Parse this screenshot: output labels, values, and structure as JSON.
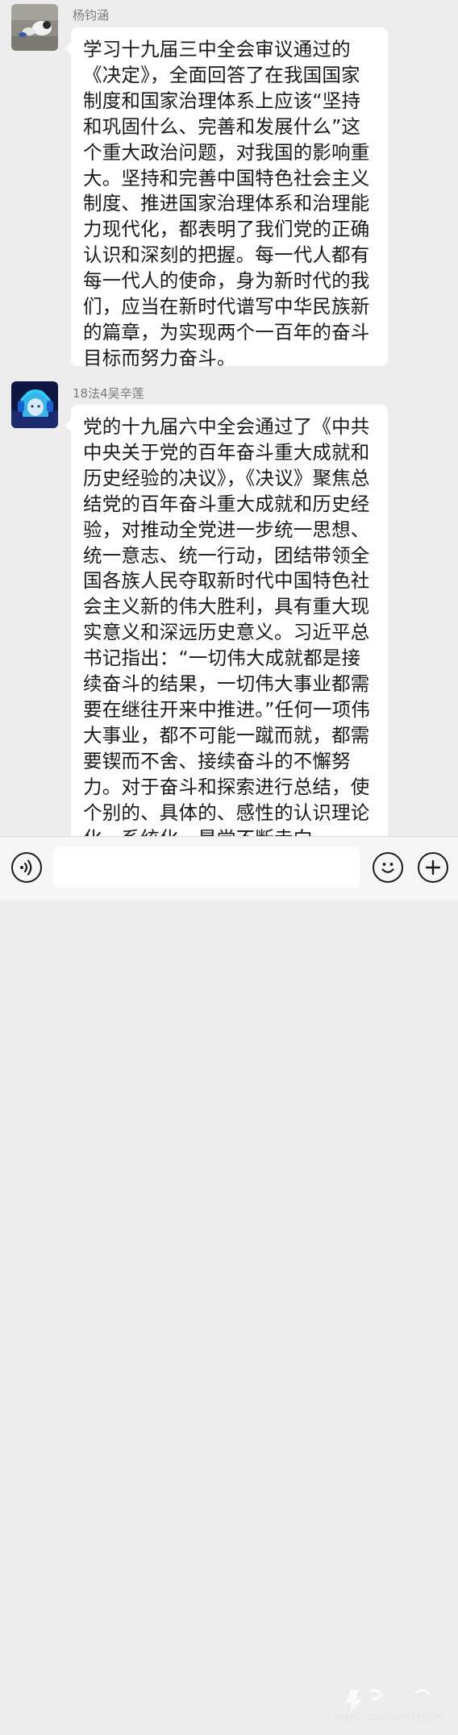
{
  "messages": [
    {
      "sender": "杨钧涵",
      "avatar": "photo-avatar",
      "text": "学习十九届三中全会审议通过的《决定》，全面回答了在我国国家制度和国家治理体系上应该“坚持和巩固什么、完善和发展什么”这个重大政治问题，对我国的影响重大。坚持和完善中国特色社会主义制度、推进国家治理体系和治理能力现代化，都表明了我们党的正确认识和深刻的把握。每一代人都有每一代人的使命，身为新时代的我们，应当在新时代谱写中华民族新的篇章，为实现两个一百年的奋斗目标而努力奋斗。"
    },
    {
      "sender": "18法4吴辛莲",
      "avatar": "anime-headphone-avatar",
      "text": "党的十九届六中全会通过了《中共中央关于党的百年奋斗重大成就和历史经验的决议》，《决议》聚焦总结党的百年奋斗重大成就和历史经验，对推动全党进一步统一思想、统一意志、统一行动，团结带领全国各族人民夺取新时代中国特色社会主义新的伟大胜利，具有重大现实意义和深远历史意义。习近平总书记指出：“一切伟大成就都是接续奋斗的结果，一切伟大事业都需要在继往开来中推进。”任何一项伟大事业，都不可能一蹴而就，都需要锲而不舍、接续奋斗的不懈努力。对于奋斗和探索进行总结，使个别的、具体的、感性的认识理论化、系统化，是党不断走向"
    }
  ],
  "input_bar": {
    "voice_icon": "voice-icon",
    "emoji_icon": "emoji-icon",
    "plus_icon": "plus-icon",
    "input_value": ""
  },
  "watermark": {
    "text": "WENZHOU UNIVERSITY"
  },
  "colors": {
    "background": "#ededed",
    "bubble": "#ffffff",
    "text": "#1a1a1a",
    "sender": "#7b7b7b"
  }
}
